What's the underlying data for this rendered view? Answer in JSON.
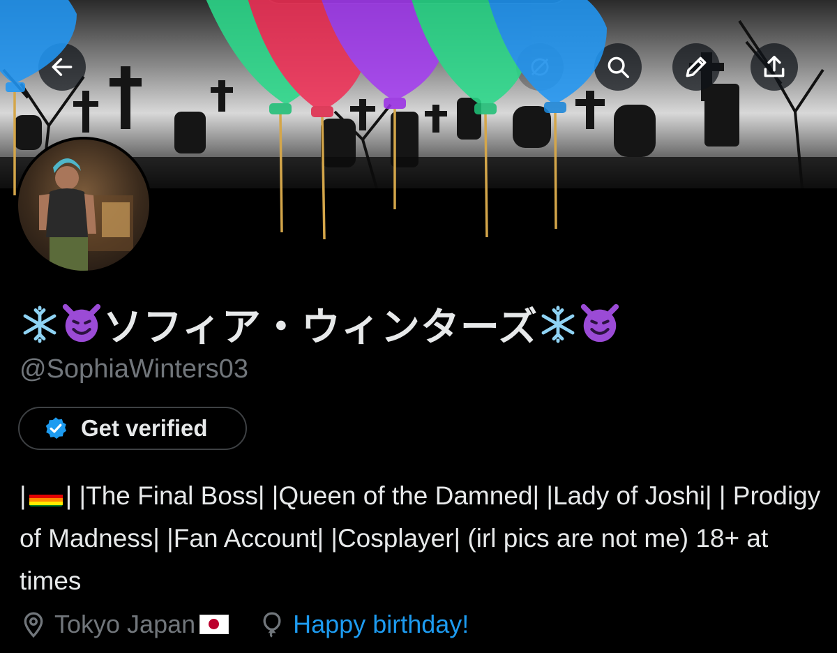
{
  "header": {
    "back_icon": "arrow-left-icon",
    "actions": [
      {
        "name": "grok-icon"
      },
      {
        "name": "search-icon"
      },
      {
        "name": "edit-icon"
      },
      {
        "name": "share-icon"
      }
    ]
  },
  "profile": {
    "display_name_text": "ソフィア・ウィンターズ",
    "display_name_emoji_left": [
      "snowflake",
      "smiling-imp"
    ],
    "display_name_emoji_right": [
      "snowflake",
      "smiling-imp"
    ],
    "handle": "@SophiaWinters03",
    "verify_button_label": "Get verified",
    "bio": {
      "prefix": "|",
      "rest": "| |The Final Boss| |Queen of the Damned| |Lady of Joshi| | Prodigy of Madness| |Fan Account| |Cosplayer| (irl pics are not me) 18+ at times"
    },
    "location": "Tokyo Japan",
    "birthday_link": "Happy birthday!"
  },
  "colors": {
    "accent": "#1d9bf0",
    "muted_text": "#71767b",
    "primary_text": "#e7e9ea",
    "background": "#000000"
  }
}
